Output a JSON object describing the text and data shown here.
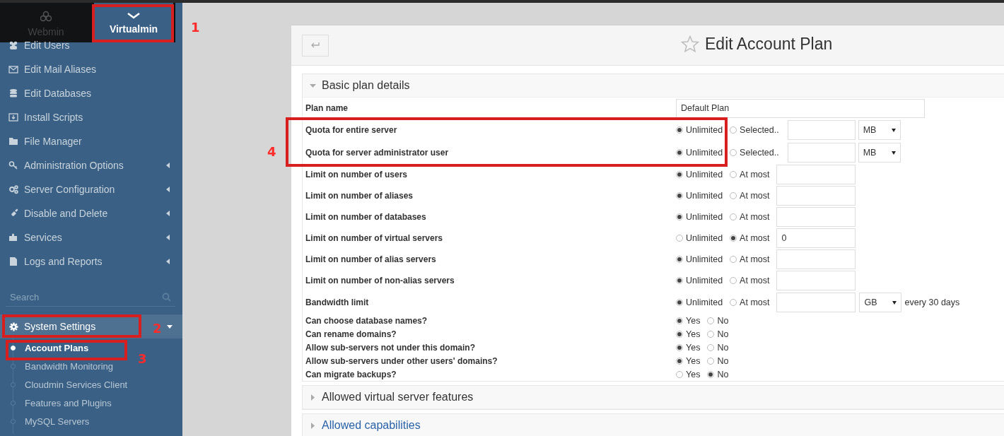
{
  "product_tabs": [
    {
      "label": "Webmin",
      "selected": false
    },
    {
      "label": "Virtualmin",
      "selected": true
    }
  ],
  "sidebar": {
    "items": [
      {
        "label": "Edit Users",
        "expandable": false
      },
      {
        "label": "Edit Mail Aliases",
        "expandable": false
      },
      {
        "label": "Edit Databases",
        "expandable": false
      },
      {
        "label": "Install Scripts",
        "expandable": false
      },
      {
        "label": "File Manager",
        "expandable": false
      },
      {
        "label": "Administration Options",
        "expandable": true
      },
      {
        "label": "Server Configuration",
        "expandable": true
      },
      {
        "label": "Disable and Delete",
        "expandable": true
      },
      {
        "label": "Services",
        "expandable": true
      },
      {
        "label": "Logs and Reports",
        "expandable": true
      }
    ],
    "search": {
      "placeholder": "Search"
    },
    "open_group": {
      "label": "System Settings",
      "expanded": true,
      "children": [
        {
          "label": "Account Plans",
          "selected": true
        },
        {
          "label": "Bandwidth Monitoring",
          "selected": false
        },
        {
          "label": "Cloudmin Services Client",
          "selected": false
        },
        {
          "label": "Features and Plugins",
          "selected": false
        },
        {
          "label": "MySQL Servers",
          "selected": false
        }
      ]
    }
  },
  "page": {
    "title": "Edit Account Plan"
  },
  "sections": [
    {
      "title": "Basic plan details",
      "expanded": true,
      "link": false,
      "rows": [
        {
          "kind": "text",
          "label": "Plan name",
          "value": "Default Plan"
        },
        {
          "kind": "quota",
          "label": "Quota for entire server",
          "options": [
            {
              "label": "Unlimited",
              "selected": true
            },
            {
              "label": "Selected..",
              "selected": false
            }
          ],
          "unit": "MB"
        },
        {
          "kind": "quota",
          "label": "Quota for server administrator user",
          "options": [
            {
              "label": "Unlimited",
              "selected": true
            },
            {
              "label": "Selected..",
              "selected": false
            }
          ],
          "unit": "MB"
        },
        {
          "kind": "limit",
          "label": "Limit on number of users",
          "options": [
            {
              "label": "Unlimited",
              "selected": true
            },
            {
              "label": "At most",
              "selected": false
            }
          ]
        },
        {
          "kind": "limit",
          "label": "Limit on number of aliases",
          "options": [
            {
              "label": "Unlimited",
              "selected": true
            },
            {
              "label": "At most",
              "selected": false
            }
          ]
        },
        {
          "kind": "limit",
          "label": "Limit on number of databases",
          "options": [
            {
              "label": "Unlimited",
              "selected": true
            },
            {
              "label": "At most",
              "selected": false
            }
          ]
        },
        {
          "kind": "limit",
          "label": "Limit on number of virtual servers",
          "options": [
            {
              "label": "Unlimited",
              "selected": false
            },
            {
              "label": "At most",
              "selected": true
            }
          ],
          "value": "0"
        },
        {
          "kind": "limit",
          "label": "Limit on number of alias servers",
          "options": [
            {
              "label": "Unlimited",
              "selected": true
            },
            {
              "label": "At most",
              "selected": false
            }
          ]
        },
        {
          "kind": "limit",
          "label": "Limit on number of non-alias servers",
          "options": [
            {
              "label": "Unlimited",
              "selected": true
            },
            {
              "label": "At most",
              "selected": false
            }
          ]
        },
        {
          "kind": "bandwidth",
          "label": "Bandwidth limit",
          "options": [
            {
              "label": "Unlimited",
              "selected": true
            },
            {
              "label": "At most",
              "selected": false
            }
          ],
          "unit": "GB",
          "suffix": "every 30 days"
        },
        {
          "kind": "yesno",
          "label": "Can choose database names?",
          "options": [
            {
              "label": "Yes",
              "selected": true
            },
            {
              "label": "No",
              "selected": false
            }
          ]
        },
        {
          "kind": "yesno",
          "label": "Can rename domains?",
          "options": [
            {
              "label": "Yes",
              "selected": true
            },
            {
              "label": "No",
              "selected": false
            }
          ]
        },
        {
          "kind": "yesno",
          "label": "Allow sub-servers not under this domain?",
          "options": [
            {
              "label": "Yes",
              "selected": true
            },
            {
              "label": "No",
              "selected": false
            }
          ]
        },
        {
          "kind": "yesno",
          "label": "Allow sub-servers under other users' domains?",
          "options": [
            {
              "label": "Yes",
              "selected": true
            },
            {
              "label": "No",
              "selected": false
            }
          ]
        },
        {
          "kind": "yesno",
          "label": "Can migrate backups?",
          "options": [
            {
              "label": "Yes",
              "selected": false
            },
            {
              "label": "No",
              "selected": true
            }
          ]
        }
      ]
    },
    {
      "title": "Allowed virtual server features",
      "expanded": false,
      "link": false
    },
    {
      "title": "Allowed capabilities",
      "expanded": false,
      "link": true
    }
  ],
  "annotations": [
    {
      "label": "1"
    },
    {
      "label": "2"
    },
    {
      "label": "3"
    },
    {
      "label": "4"
    }
  ]
}
